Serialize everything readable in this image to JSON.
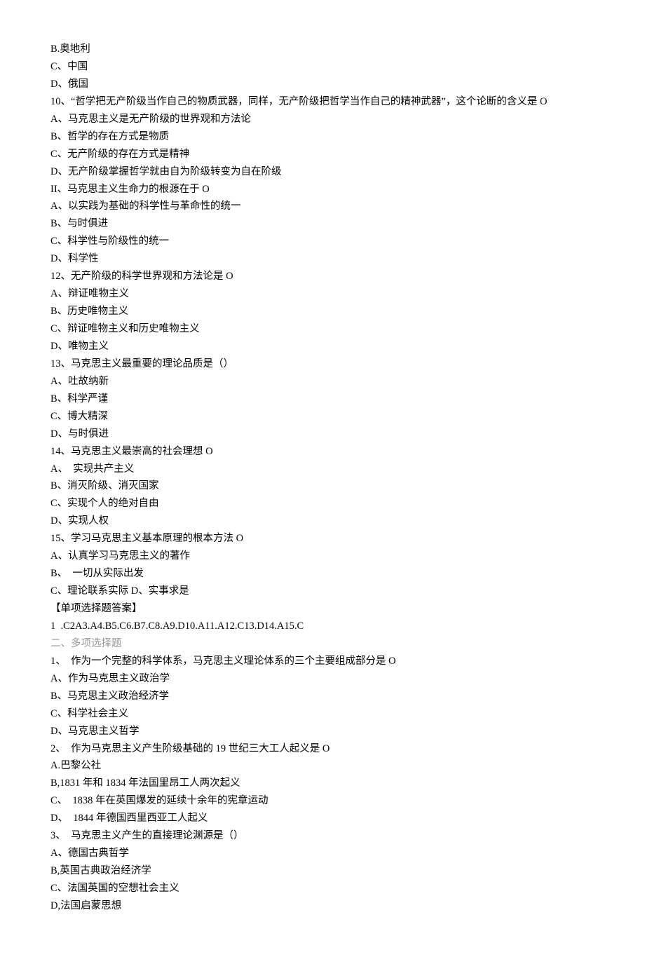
{
  "lines": [
    {
      "text": "B.奥地利"
    },
    {
      "text": "C、中国"
    },
    {
      "text": "D、俄国"
    },
    {
      "text": "10、“哲学把无产阶级当作自己的物质武器，同样，无产阶级把哲学当作自己的精神武器”，这个论断的含义是 O"
    },
    {
      "text": "A、马克思主义是无产阶级的世界观和方法论"
    },
    {
      "text": "B、哲学的存在方式是物质"
    },
    {
      "text": "C、无产阶级的存在方式是精神"
    },
    {
      "text": "D、无产阶级掌握哲学就由自为阶级转变为自在阶级"
    },
    {
      "text": "II、马克思主义生命力的根源在于 O"
    },
    {
      "text": "A、以实践为基础的科学性与革命性的统一"
    },
    {
      "text": "B、与时俱进"
    },
    {
      "text": "C、科学性与阶级性的统一"
    },
    {
      "text": "D、科学性"
    },
    {
      "text": "12、无产阶级的科学世界观和方法论是 O"
    },
    {
      "text": "A、辩证唯物主义"
    },
    {
      "text": "B、历史唯物主义"
    },
    {
      "text": "C、辩证唯物主义和历史唯物主义"
    },
    {
      "text": "D、唯物主义"
    },
    {
      "text": "13、马克思主义最重要的理论品质是（）"
    },
    {
      "text": "A、吐故纳新"
    },
    {
      "text": "B、科学严谨"
    },
    {
      "text": "C、博大精深"
    },
    {
      "text": "D、与时俱进"
    },
    {
      "text": "14、马克思主义最崇高的社会理想 O"
    },
    {
      "text": "A、　实现共产主义"
    },
    {
      "text": "B、消灭阶级、消灭国家"
    },
    {
      "text": "C、实现个人的绝对自由"
    },
    {
      "text": "D、实现人权"
    },
    {
      "text": "15、学习马克思主义基本原理的根本方法 O"
    },
    {
      "text": "A、认真学习马克思主义的著作"
    },
    {
      "text": "B、　一切从实际出发"
    },
    {
      "text": "C、理论联系实际 D、实事求是"
    },
    {
      "text": "【单项选择题答案】"
    },
    {
      "text": "1  .C2A3.A4.B5.C6.B7.C8.A9.D10.A11.A12.C13.D14.A15.C"
    },
    {
      "text": "二、多项选择题",
      "faint": true
    },
    {
      "text": "1、　作为一个完整的科学体系，马克思主义理论体系的三个主要组成部分是 O"
    },
    {
      "text": "A、作为马克思主义政治学"
    },
    {
      "text": "B、马克思主义政治经济学"
    },
    {
      "text": "C、科学社会主义"
    },
    {
      "text": "D、马克思主义哲学"
    },
    {
      "text": "2、　作为马克思主义产生阶级基础的 19 世纪三大工人起义是 O"
    },
    {
      "text": "A.巴黎公社"
    },
    {
      "text": "B,1831 年和 1834 年法国里昂工人两次起义"
    },
    {
      "text": "C、　1838 年在英国爆发的延续十余年的宪章运动"
    },
    {
      "text": "D、　1844 年德国西里西亚工人起义"
    },
    {
      "text": "3、　马克思主义产生的直接理论渊源是（）"
    },
    {
      "text": "A、德国古典哲学"
    },
    {
      "text": "B,英国古典政治经济学"
    },
    {
      "text": "C、法国英国的空想社会主义"
    },
    {
      "text": "D,法国启蒙思想"
    }
  ]
}
